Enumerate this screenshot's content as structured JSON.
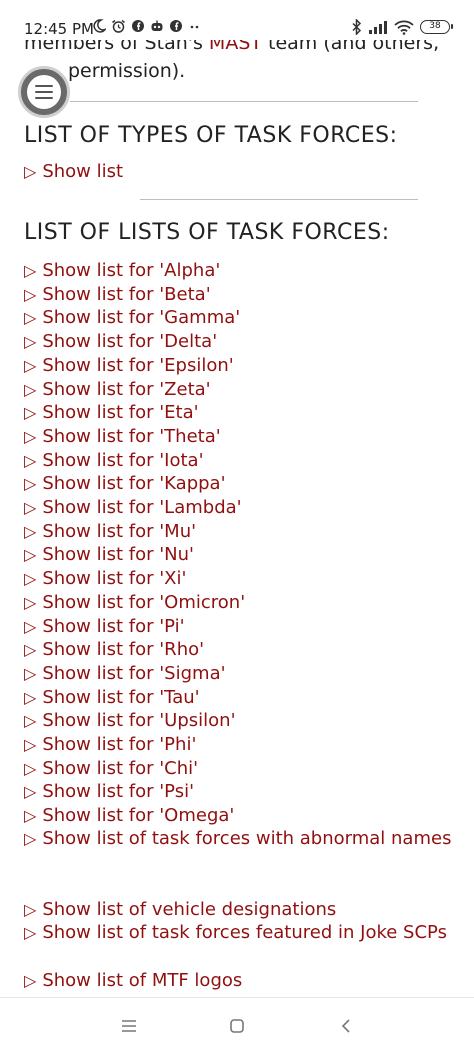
{
  "status": {
    "time": "12:45 PM",
    "battery": "38"
  },
  "page": {
    "cut_text_before": "members of Stan's ",
    "cut_text_link": "MAST",
    "cut_text_after": " team (and others,",
    "permission_text": "permission).",
    "types_heading": "LIST OF TYPES OF TASK FORCES:",
    "types_toggle": "Show list",
    "lists_heading": "LIST OF LISTS OF TASK FORCES:",
    "triangle": "▷",
    "lists": [
      "Show list for 'Alpha'",
      "Show list for 'Beta'",
      "Show list for 'Gamma'",
      "Show list for 'Delta'",
      "Show list for 'Epsilon'",
      "Show list for 'Zeta'",
      "Show list for 'Eta'",
      "Show list for 'Theta'",
      "Show list for 'Iota'",
      "Show list for 'Kappa'",
      "Show list for 'Lambda'",
      "Show list for 'Mu'",
      "Show list for 'Nu'",
      "Show list for 'Xi'",
      "Show list for 'Omicron'",
      "Show list for 'Pi'",
      "Show list for 'Rho'",
      "Show list for 'Sigma'",
      "Show list for 'Tau'",
      "Show list for 'Upsilon'",
      "Show list for 'Phi'",
      "Show list for 'Chi'",
      "Show list for 'Psi'",
      "Show list for 'Omega'"
    ],
    "abnormal_names": "Show list of task forces with abnormal names",
    "vehicle_designations": "Show list of vehicle designations",
    "joke_scps": "Show list of task forces featured in Joke SCPs",
    "mtf_logos": "Show list of MTF logos"
  },
  "colors": {
    "link": "#901010",
    "text": "#222222"
  },
  "icons": {
    "menu_fab": "hamburger-menu-icon",
    "nav_menu": "recent-apps-icon",
    "nav_home": "home-icon",
    "nav_back": "back-icon"
  }
}
